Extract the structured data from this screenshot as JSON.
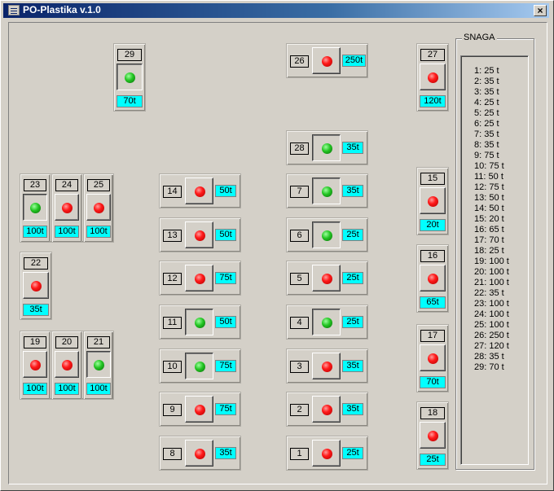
{
  "window": {
    "title": "PO-Plastika v.1.0",
    "close_label": "×"
  },
  "colors": {
    "titlebar": "#0a246a",
    "capacity_bg": "#00ffff",
    "led_on": "#22c422",
    "led_off": "#ff1a1a",
    "face": "#d4d0c8"
  },
  "machines": [
    {
      "id": "29",
      "capacity": "70t",
      "on": true
    },
    {
      "id": "26",
      "capacity": "250t",
      "on": false
    },
    {
      "id": "27",
      "capacity": "120t",
      "on": false
    },
    {
      "id": "28",
      "capacity": "35t",
      "on": true
    },
    {
      "id": "23",
      "capacity": "100t",
      "on": true
    },
    {
      "id": "24",
      "capacity": "100t",
      "on": false
    },
    {
      "id": "25",
      "capacity": "100t",
      "on": false
    },
    {
      "id": "14",
      "capacity": "50t",
      "on": false
    },
    {
      "id": "7",
      "capacity": "35t",
      "on": true
    },
    {
      "id": "15",
      "capacity": "20t",
      "on": false
    },
    {
      "id": "13",
      "capacity": "50t",
      "on": false
    },
    {
      "id": "6",
      "capacity": "25t",
      "on": true
    },
    {
      "id": "22",
      "capacity": "35t",
      "on": false
    },
    {
      "id": "12",
      "capacity": "75t",
      "on": false
    },
    {
      "id": "5",
      "capacity": "25t",
      "on": false
    },
    {
      "id": "16",
      "capacity": "65t",
      "on": false
    },
    {
      "id": "11",
      "capacity": "50t",
      "on": true
    },
    {
      "id": "4",
      "capacity": "25t",
      "on": true
    },
    {
      "id": "19",
      "capacity": "100t",
      "on": false
    },
    {
      "id": "20",
      "capacity": "100t",
      "on": false
    },
    {
      "id": "21",
      "capacity": "100t",
      "on": true
    },
    {
      "id": "10",
      "capacity": "75t",
      "on": true
    },
    {
      "id": "3",
      "capacity": "35t",
      "on": false
    },
    {
      "id": "17",
      "capacity": "70t",
      "on": false
    },
    {
      "id": "9",
      "capacity": "75t",
      "on": false
    },
    {
      "id": "2",
      "capacity": "35t",
      "on": false
    },
    {
      "id": "18",
      "capacity": "25t",
      "on": false
    },
    {
      "id": "8",
      "capacity": "35t",
      "on": false
    },
    {
      "id": "1",
      "capacity": "25t",
      "on": false
    }
  ],
  "snaga": {
    "title": "SNAGA",
    "items": [
      "1: 25 t",
      "2: 35 t",
      "3: 35 t",
      "4: 25 t",
      "5: 25 t",
      "6: 25 t",
      "7: 35 t",
      "8: 35 t",
      "9: 75 t",
      "10: 75 t",
      "11: 50 t",
      "12: 75 t",
      "13: 50 t",
      "14: 50 t",
      "15: 20 t",
      "16: 65 t",
      "17: 70 t",
      "18: 25 t",
      "19: 100 t",
      "20: 100 t",
      "21: 100 t",
      "22: 35 t",
      "23: 100 t",
      "24: 100 t",
      "25: 100 t",
      "26: 250 t",
      "27: 120 t",
      "28: 35 t",
      "29: 70 t"
    ]
  }
}
